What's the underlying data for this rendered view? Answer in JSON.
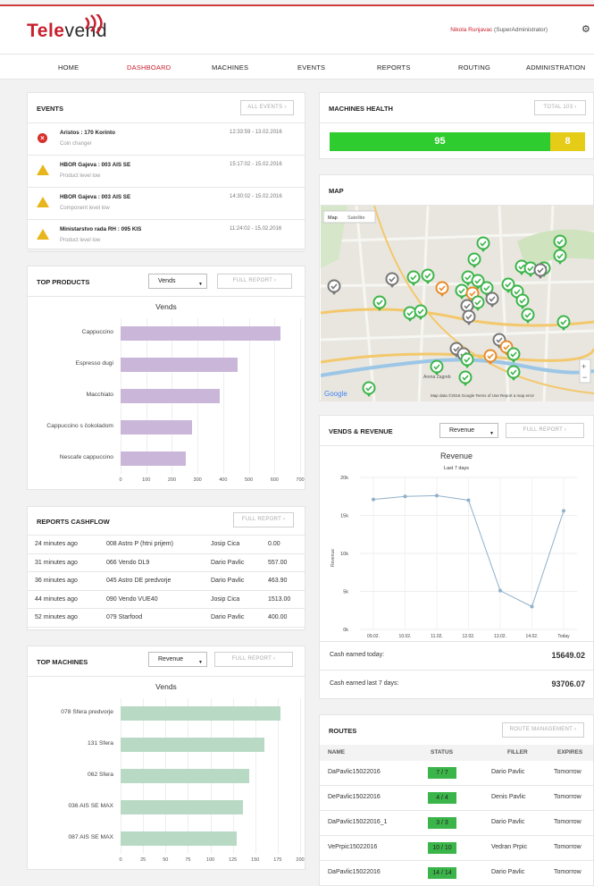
{
  "app": {
    "logo_a": "Tele",
    "logo_b": "vend",
    "user": "Nikola Runjavac",
    "role": " (SuperAdministrator)"
  },
  "nav": [
    {
      "label": "HOME"
    },
    {
      "label": "DASHBOARD"
    },
    {
      "label": "MACHINES"
    },
    {
      "label": "EVENTS"
    },
    {
      "label": "REPORTS"
    },
    {
      "label": "ROUTING"
    },
    {
      "label": "ADMINISTRATION"
    }
  ],
  "events": {
    "title": "EVENTS",
    "button": "ALL EVENTS",
    "items": [
      {
        "name": "Aristos : 170 Korinto",
        "desc": "Coin changer",
        "time": "12:33:59 - 13.02.2016",
        "level": "error"
      },
      {
        "name": "HBOR Gajeva : 003 AIS SE",
        "desc": "Product level low",
        "time": "15:17:02 - 15.02.2016",
        "level": "warning"
      },
      {
        "name": "HBOR Gajeva : 003 AIS SE",
        "desc": "Component level low",
        "time": "14:30:02 - 15.02.2016",
        "level": "warning"
      },
      {
        "name": "Ministarstvo rada RH : 095 KIS",
        "desc": "Product level low",
        "time": "11:24:02 - 15.02.2016",
        "level": "warning"
      }
    ]
  },
  "health": {
    "title": "MACHINES HEALTH",
    "button": "TOTAL 103",
    "ok": 95,
    "warn": 8,
    "ok_color": "#2ecc2e",
    "warn_color": "#e5cc16"
  },
  "map": {
    "title": "MAP",
    "tab_map": "Map",
    "tab_sat": "Satellite",
    "google": "Google",
    "attribution": "Map data ©2016 Google  Terms of Use  Report a map error",
    "label1": "Arena Zagreb",
    "label2": "Lučko"
  },
  "top_products": {
    "title": "TOP PRODUCTS",
    "select": "Vends",
    "button": "FULL REPORT",
    "chart_data": {
      "type": "bar",
      "title": "Vends",
      "categories": [
        "Cappuccino",
        "Espresso dugi",
        "Macchiato",
        "Cappuccino s čokoladom",
        "Nescafe cappuccino"
      ],
      "values": [
        625,
        455,
        385,
        280,
        255
      ],
      "xlim": [
        0,
        700
      ],
      "ticks": [
        0,
        100,
        200,
        300,
        400,
        500,
        600,
        700
      ],
      "color": "#c9b6d9"
    }
  },
  "cashflow": {
    "title": "REPORTS CASHFLOW",
    "button": "FULL REPORT",
    "rows": [
      [
        "24 minutes ago",
        "008 Astro P (htni prijem)",
        "Josip Cica",
        "0.00"
      ],
      [
        "31 minutes ago",
        "066 Vendo DL9",
        "Dario Pavlic",
        "557.00"
      ],
      [
        "36 minutes ago",
        "045 Astro DE predvorje",
        "Dario Pavlic",
        "463.90"
      ],
      [
        "44 minutes ago",
        "090 Vendo VUE40",
        "Josip Cica",
        "1513.00"
      ],
      [
        "52 minutes ago",
        "079 Starfood",
        "Dario Pavlic",
        "400.00"
      ]
    ]
  },
  "top_machines": {
    "title": "TOP MACHINES",
    "select": "Revenue",
    "button": "FULL REPORT",
    "chart_data": {
      "type": "bar",
      "title": "Vends",
      "categories": [
        "078 Sfera predvorje",
        "131 Sfera",
        "062 Sfera",
        "036 AIS SE MAX",
        "087 AIS SE MAX"
      ],
      "values": [
        178,
        160,
        143,
        136,
        129
      ],
      "xlim": [
        0,
        200
      ],
      "ticks": [
        0,
        25,
        50,
        75,
        100,
        125,
        150,
        175,
        200
      ],
      "color": "#b8d9c4"
    }
  },
  "vends_revenue": {
    "title": "VENDS & REVENUE",
    "select": "Revenue",
    "button": "FULL REPORT",
    "chart_data": {
      "type": "line",
      "title": "Revenue",
      "subtitle": "Last 7 days",
      "ylabel": "Revenue",
      "categories": [
        "09.02.",
        "10.02.",
        "11.02.",
        "12.02.",
        "13.02.",
        "14.02.",
        "Today"
      ],
      "values": [
        17100,
        17500,
        17600,
        17000,
        5100,
        3000,
        15600
      ],
      "ylim": [
        0,
        20000
      ],
      "yticks": [
        "0k",
        "5k",
        "10k",
        "15k",
        "20k"
      ],
      "color": "#8fb0c9"
    },
    "cash_today_label": "Cash earned today:",
    "cash_today": "15649.02",
    "cash_week_label": "Cash earned last 7 days:",
    "cash_week": "93706.07"
  },
  "routes": {
    "title": "ROUTES",
    "button": "ROUTE MANAGEMENT",
    "headers": [
      "NAME",
      "STATUS",
      "FILLER",
      "EXPIRES"
    ],
    "rows": [
      [
        "DaPavlic15022016",
        "7 / 7",
        "Dario Pavlic",
        "Tomorrow"
      ],
      [
        "DePavlic15022016",
        "4 / 4",
        "Denis Pavlic",
        "Tomorrow"
      ],
      [
        "DaPavlic15022016_1",
        "3 / 3",
        "Dario Pavlic",
        "Tomorrow"
      ],
      [
        "VePrpic15022016",
        "10 / 10",
        "Vedran Prpic",
        "Tomorrow"
      ],
      [
        "DaPavlic15022016",
        "14 / 14",
        "Dario Pavlic",
        "Tomorrow"
      ]
    ]
  }
}
